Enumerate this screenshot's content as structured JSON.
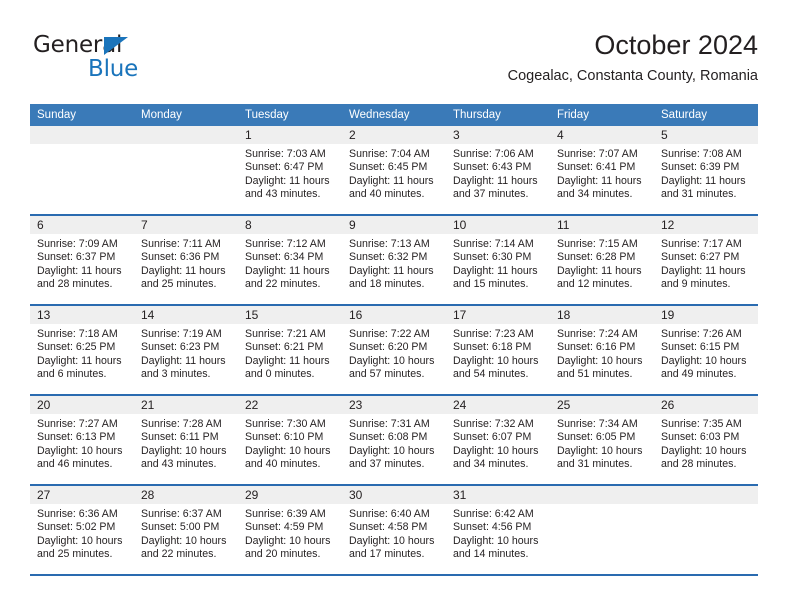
{
  "brand": {
    "word1": "General",
    "word2": "Blue",
    "logo_icon": "triangle-flag-icon",
    "accent_color": "#1a74bb"
  },
  "header": {
    "title": "October 2024",
    "subtitle": "Cogealac, Constanta County, Romania"
  },
  "calendar": {
    "header_bg": "#3a7ab8",
    "row_separator_color": "#2a6bb0",
    "daynum_band_bg": "#efefef",
    "weekday_headers": [
      "Sunday",
      "Monday",
      "Tuesday",
      "Wednesday",
      "Thursday",
      "Friday",
      "Saturday"
    ],
    "weeks": [
      [
        {
          "day": "",
          "lines": []
        },
        {
          "day": "",
          "lines": []
        },
        {
          "day": "1",
          "lines": [
            "Sunrise: 7:03 AM",
            "Sunset: 6:47 PM",
            "Daylight: 11 hours",
            "and 43 minutes."
          ]
        },
        {
          "day": "2",
          "lines": [
            "Sunrise: 7:04 AM",
            "Sunset: 6:45 PM",
            "Daylight: 11 hours",
            "and 40 minutes."
          ]
        },
        {
          "day": "3",
          "lines": [
            "Sunrise: 7:06 AM",
            "Sunset: 6:43 PM",
            "Daylight: 11 hours",
            "and 37 minutes."
          ]
        },
        {
          "day": "4",
          "lines": [
            "Sunrise: 7:07 AM",
            "Sunset: 6:41 PM",
            "Daylight: 11 hours",
            "and 34 minutes."
          ]
        },
        {
          "day": "5",
          "lines": [
            "Sunrise: 7:08 AM",
            "Sunset: 6:39 PM",
            "Daylight: 11 hours",
            "and 31 minutes."
          ]
        }
      ],
      [
        {
          "day": "6",
          "lines": [
            "Sunrise: 7:09 AM",
            "Sunset: 6:37 PM",
            "Daylight: 11 hours",
            "and 28 minutes."
          ]
        },
        {
          "day": "7",
          "lines": [
            "Sunrise: 7:11 AM",
            "Sunset: 6:36 PM",
            "Daylight: 11 hours",
            "and 25 minutes."
          ]
        },
        {
          "day": "8",
          "lines": [
            "Sunrise: 7:12 AM",
            "Sunset: 6:34 PM",
            "Daylight: 11 hours",
            "and 22 minutes."
          ]
        },
        {
          "day": "9",
          "lines": [
            "Sunrise: 7:13 AM",
            "Sunset: 6:32 PM",
            "Daylight: 11 hours",
            "and 18 minutes."
          ]
        },
        {
          "day": "10",
          "lines": [
            "Sunrise: 7:14 AM",
            "Sunset: 6:30 PM",
            "Daylight: 11 hours",
            "and 15 minutes."
          ]
        },
        {
          "day": "11",
          "lines": [
            "Sunrise: 7:15 AM",
            "Sunset: 6:28 PM",
            "Daylight: 11 hours",
            "and 12 minutes."
          ]
        },
        {
          "day": "12",
          "lines": [
            "Sunrise: 7:17 AM",
            "Sunset: 6:27 PM",
            "Daylight: 11 hours",
            "and 9 minutes."
          ]
        }
      ],
      [
        {
          "day": "13",
          "lines": [
            "Sunrise: 7:18 AM",
            "Sunset: 6:25 PM",
            "Daylight: 11 hours",
            "and 6 minutes."
          ]
        },
        {
          "day": "14",
          "lines": [
            "Sunrise: 7:19 AM",
            "Sunset: 6:23 PM",
            "Daylight: 11 hours",
            "and 3 minutes."
          ]
        },
        {
          "day": "15",
          "lines": [
            "Sunrise: 7:21 AM",
            "Sunset: 6:21 PM",
            "Daylight: 11 hours",
            "and 0 minutes."
          ]
        },
        {
          "day": "16",
          "lines": [
            "Sunrise: 7:22 AM",
            "Sunset: 6:20 PM",
            "Daylight: 10 hours",
            "and 57 minutes."
          ]
        },
        {
          "day": "17",
          "lines": [
            "Sunrise: 7:23 AM",
            "Sunset: 6:18 PM",
            "Daylight: 10 hours",
            "and 54 minutes."
          ]
        },
        {
          "day": "18",
          "lines": [
            "Sunrise: 7:24 AM",
            "Sunset: 6:16 PM",
            "Daylight: 10 hours",
            "and 51 minutes."
          ]
        },
        {
          "day": "19",
          "lines": [
            "Sunrise: 7:26 AM",
            "Sunset: 6:15 PM",
            "Daylight: 10 hours",
            "and 49 minutes."
          ]
        }
      ],
      [
        {
          "day": "20",
          "lines": [
            "Sunrise: 7:27 AM",
            "Sunset: 6:13 PM",
            "Daylight: 10 hours",
            "and 46 minutes."
          ]
        },
        {
          "day": "21",
          "lines": [
            "Sunrise: 7:28 AM",
            "Sunset: 6:11 PM",
            "Daylight: 10 hours",
            "and 43 minutes."
          ]
        },
        {
          "day": "22",
          "lines": [
            "Sunrise: 7:30 AM",
            "Sunset: 6:10 PM",
            "Daylight: 10 hours",
            "and 40 minutes."
          ]
        },
        {
          "day": "23",
          "lines": [
            "Sunrise: 7:31 AM",
            "Sunset: 6:08 PM",
            "Daylight: 10 hours",
            "and 37 minutes."
          ]
        },
        {
          "day": "24",
          "lines": [
            "Sunrise: 7:32 AM",
            "Sunset: 6:07 PM",
            "Daylight: 10 hours",
            "and 34 minutes."
          ]
        },
        {
          "day": "25",
          "lines": [
            "Sunrise: 7:34 AM",
            "Sunset: 6:05 PM",
            "Daylight: 10 hours",
            "and 31 minutes."
          ]
        },
        {
          "day": "26",
          "lines": [
            "Sunrise: 7:35 AM",
            "Sunset: 6:03 PM",
            "Daylight: 10 hours",
            "and 28 minutes."
          ]
        }
      ],
      [
        {
          "day": "27",
          "lines": [
            "Sunrise: 6:36 AM",
            "Sunset: 5:02 PM",
            "Daylight: 10 hours",
            "and 25 minutes."
          ]
        },
        {
          "day": "28",
          "lines": [
            "Sunrise: 6:37 AM",
            "Sunset: 5:00 PM",
            "Daylight: 10 hours",
            "and 22 minutes."
          ]
        },
        {
          "day": "29",
          "lines": [
            "Sunrise: 6:39 AM",
            "Sunset: 4:59 PM",
            "Daylight: 10 hours",
            "and 20 minutes."
          ]
        },
        {
          "day": "30",
          "lines": [
            "Sunrise: 6:40 AM",
            "Sunset: 4:58 PM",
            "Daylight: 10 hours",
            "and 17 minutes."
          ]
        },
        {
          "day": "31",
          "lines": [
            "Sunrise: 6:42 AM",
            "Sunset: 4:56 PM",
            "Daylight: 10 hours",
            "and 14 minutes."
          ]
        },
        {
          "day": "",
          "lines": []
        },
        {
          "day": "",
          "lines": []
        }
      ]
    ]
  }
}
